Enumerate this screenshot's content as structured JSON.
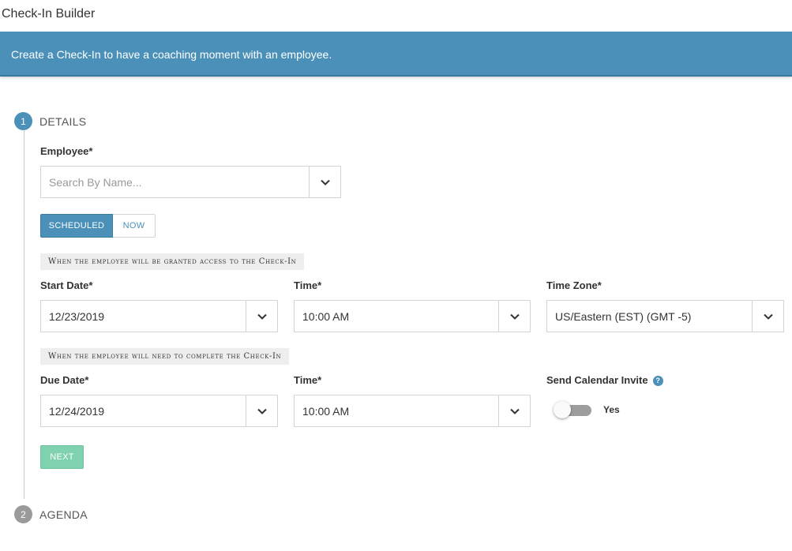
{
  "header": {
    "title": "Check-In Builder"
  },
  "banner": {
    "text": "Create a Check-In to have a coaching moment with an employee."
  },
  "steps": [
    {
      "number": "1",
      "label": "DETAILS"
    },
    {
      "number": "2",
      "label": "AGENDA"
    }
  ],
  "employee": {
    "label": "Employee*",
    "placeholder": "Search By Name..."
  },
  "mode": {
    "scheduled": "SCHEDULED",
    "now": "NOW",
    "selected": "SCHEDULED"
  },
  "access_section": {
    "label": "When the employee will be granted access to the Check-In"
  },
  "start_date": {
    "label": "Start Date*",
    "value": "12/23/2019"
  },
  "start_time": {
    "label": "Time*",
    "value": "10:00 AM"
  },
  "time_zone": {
    "label": "Time Zone*",
    "value": "US/Eastern (EST) (GMT -5)"
  },
  "complete_section": {
    "label": "When the employee will need to complete the Check-In"
  },
  "due_date": {
    "label": "Due Date*",
    "value": "12/24/2019"
  },
  "due_time": {
    "label": "Time*",
    "value": "10:00 AM"
  },
  "calendar_invite": {
    "label": "Send Calendar Invite",
    "help": "?",
    "toggle_label": "Yes",
    "enabled": false
  },
  "next_button": {
    "label": "NEXT"
  },
  "colors": {
    "primary": "#4a90b8",
    "next": "#7fd1b0",
    "toggle_off": "#9d9d9d"
  }
}
